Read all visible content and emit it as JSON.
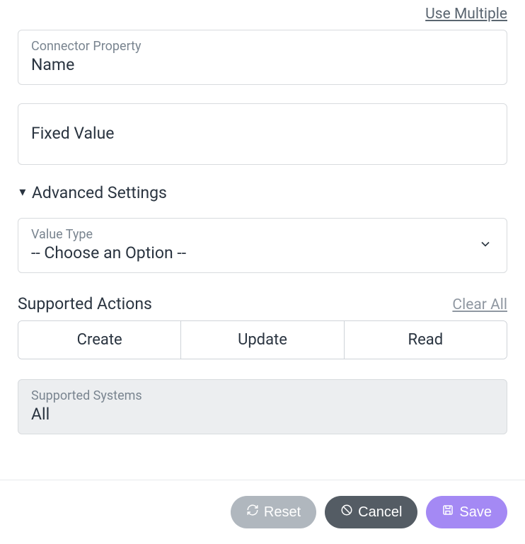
{
  "top_link": "Use Multiple",
  "connector_property": {
    "label": "Connector Property",
    "value": "Name"
  },
  "fixed_value": {
    "value": "Fixed Value"
  },
  "advanced_settings": {
    "title": "Advanced Settings"
  },
  "value_type": {
    "label": "Value Type",
    "placeholder": "-- Choose an Option --"
  },
  "supported_actions": {
    "title": "Supported Actions",
    "clear_label": "Clear All",
    "options": {
      "create": "Create",
      "update": "Update",
      "read": "Read"
    }
  },
  "supported_systems": {
    "label": "Supported Systems",
    "value": "All"
  },
  "footer": {
    "reset": "Reset",
    "cancel": "Cancel",
    "save": "Save"
  }
}
